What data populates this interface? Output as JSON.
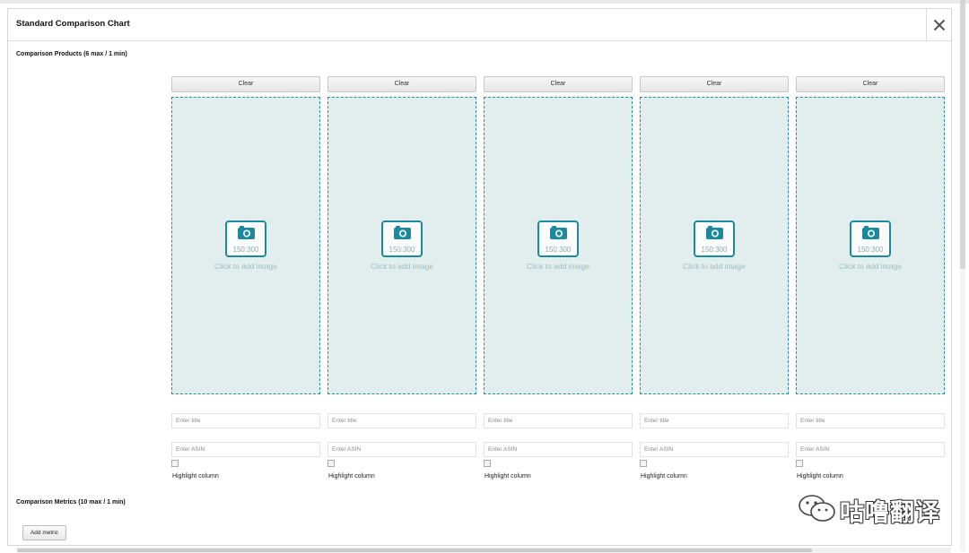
{
  "panel": {
    "title": "Standard Comparison Chart",
    "close_glyph": "✕"
  },
  "products_section": {
    "label": "Comparison Products (6 max / 1 min)",
    "columns": [
      {
        "clear_label": "Clear",
        "image_dims": "150:300",
        "add_image_text": "Click to add image",
        "title_placeholder": "Enter title",
        "title_value": "",
        "asin_placeholder": "Enter ASIN",
        "asin_value": "",
        "highlight_label": "Highlight column",
        "highlight_checked": false
      },
      {
        "clear_label": "Clear",
        "image_dims": "150:300",
        "add_image_text": "Click to add image",
        "title_placeholder": "Enter title",
        "title_value": "",
        "asin_placeholder": "Enter ASIN",
        "asin_value": "",
        "highlight_label": "Highlight column",
        "highlight_checked": false
      },
      {
        "clear_label": "Clear",
        "image_dims": "150:300",
        "add_image_text": "Click to add image",
        "title_placeholder": "Enter title",
        "title_value": "",
        "asin_placeholder": "Enter ASIN",
        "asin_value": "",
        "highlight_label": "Highlight column",
        "highlight_checked": false
      },
      {
        "clear_label": "Clear",
        "image_dims": "150:300",
        "add_image_text": "Click to add image",
        "title_placeholder": "Enter title",
        "title_value": "",
        "asin_placeholder": "Enter ASIN",
        "asin_value": "",
        "highlight_label": "Highlight column",
        "highlight_checked": false
      },
      {
        "clear_label": "Clear",
        "image_dims": "150:300",
        "add_image_text": "Click to add image",
        "title_placeholder": "Enter title",
        "title_value": "",
        "asin_placeholder": "Enter ASIN",
        "asin_value": "",
        "highlight_label": "Highlight column",
        "highlight_checked": false
      }
    ]
  },
  "metrics_section": {
    "label": "Comparison Metrics (10 max / 1 min)",
    "add_metric_label": "Add metric"
  },
  "watermark": {
    "text": "咕噜翻译",
    "icon": "wechat-icon"
  },
  "colors": {
    "accent": "#1b8aa0",
    "dropzone_bg": "#e2eded",
    "dropzone_border": "#2a8fa6",
    "placeholder_text": "#9fbec5"
  }
}
